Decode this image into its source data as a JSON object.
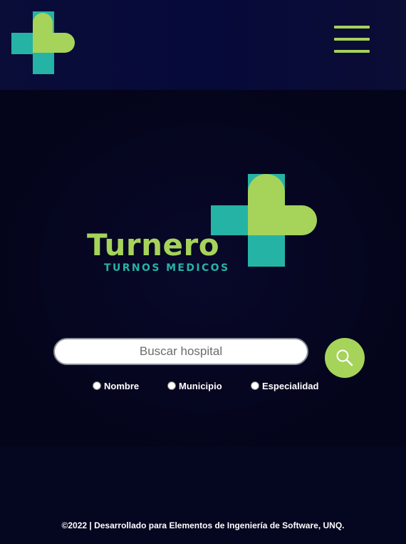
{
  "nav": {
    "logo_icon": "medical-cross-heart-icon",
    "menu_icon": "hamburger-menu-icon"
  },
  "brand": {
    "name": "Turnero",
    "tagline": "TURNOS MEDICOS",
    "colors": {
      "green": "#a6d35a",
      "teal": "#25b3a5"
    }
  },
  "search": {
    "placeholder": "Buscar hospital",
    "value": "",
    "button_icon": "search-icon",
    "options": [
      {
        "label": "Nombre",
        "checked": false
      },
      {
        "label": "Municipio",
        "checked": false
      },
      {
        "label": "Especialidad",
        "checked": false
      }
    ]
  },
  "footer": {
    "text": "©2022 | Desarrollado para Elementos de Ingeniería de Software, UNQ."
  }
}
